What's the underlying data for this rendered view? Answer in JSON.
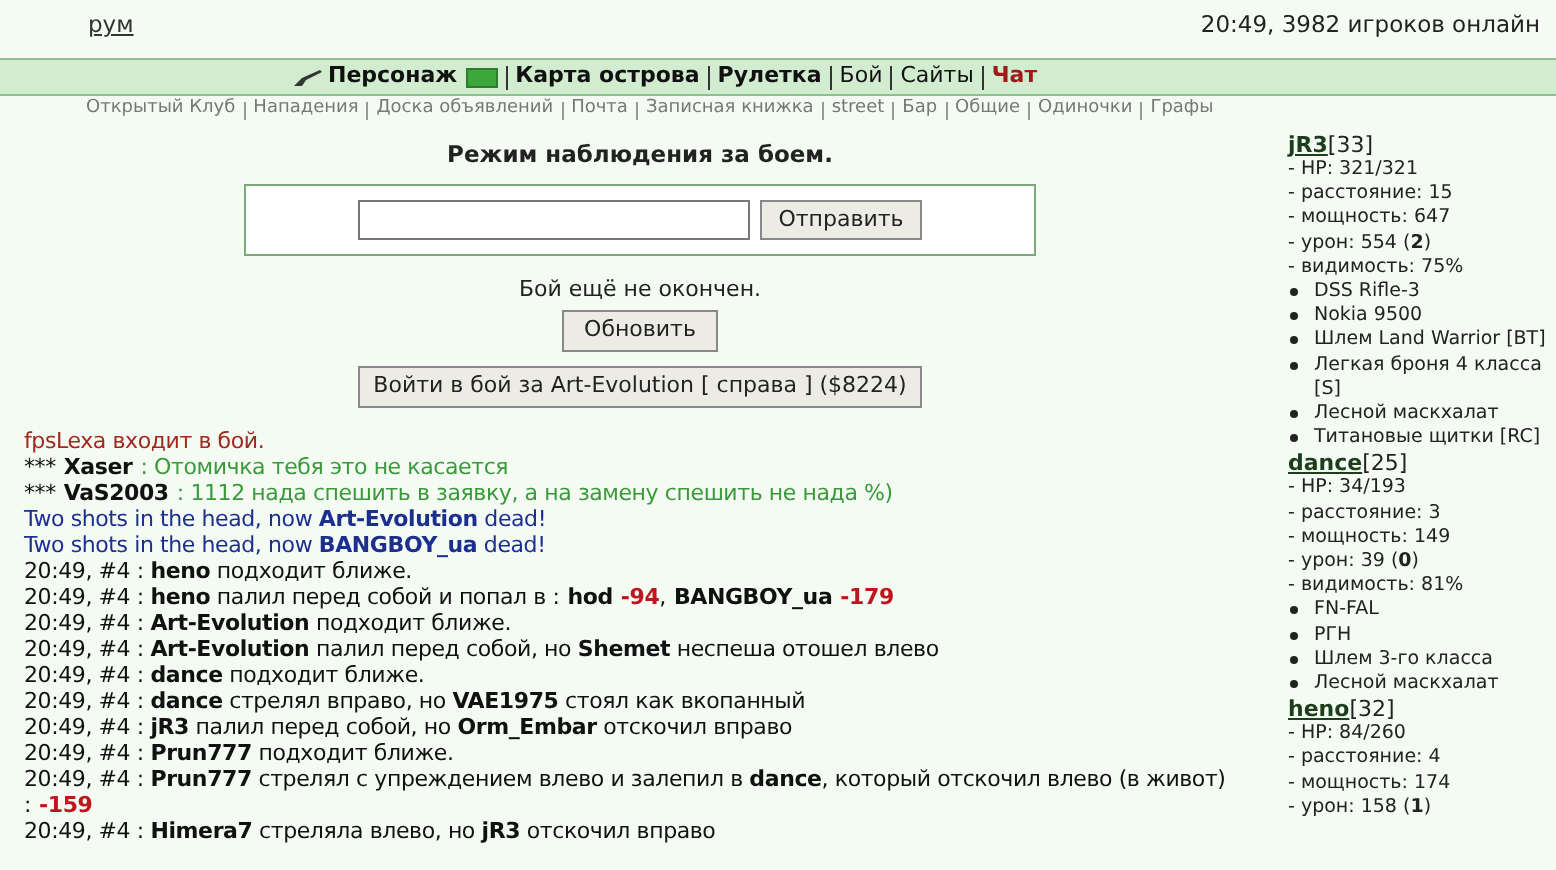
{
  "top_links": [
    "рум"
  ],
  "status": "20:49, 3982 игроков онлайн",
  "nav": [
    {
      "label": "Персонаж",
      "bold": true,
      "selected": false,
      "kind": "character"
    },
    {
      "label": "Карта острова",
      "bold": true,
      "selected": false,
      "kind": "plain"
    },
    {
      "label": "Рулетка",
      "bold": true,
      "selected": false,
      "kind": "plain"
    },
    {
      "label": "Бой",
      "bold": false,
      "selected": false,
      "kind": "plain"
    },
    {
      "label": "Сайты",
      "bold": false,
      "selected": false,
      "kind": "plain"
    },
    {
      "label": "Чат",
      "bold": true,
      "selected": true,
      "kind": "plain"
    }
  ],
  "subnav": [
    "Открытый Клуб",
    "Нападения",
    "Доска объявлений",
    "Почта",
    "Записная книжка",
    "street",
    "Бар",
    "Общие",
    "Одиночки",
    "Графы"
  ],
  "title": "Режим наблюдения за боем.",
  "send_button": "Отправить",
  "battle_status": "Бой ещё не окончен.",
  "refresh_button": "Обновить",
  "join_button": "Войти в бой за Art-Evolution [ справа ] ($8224)",
  "chat": [
    {
      "kind": "system",
      "text": "fpsLexa входит в бой."
    },
    {
      "kind": "chat",
      "prefix": "***",
      "author": "Xaser",
      "message": ": Отомичка тебя это не касается"
    },
    {
      "kind": "chat",
      "prefix": "***",
      "author": "VaS2003",
      "message": ": 1112 нада спешить в заявку, а на замену спешить не нада %)"
    },
    {
      "kind": "dead",
      "text": "Two shots in the head, now **Art-Evolution** dead!"
    },
    {
      "kind": "dead",
      "text": "Two shots in the head, now **BANGBOY_ua** dead!"
    },
    {
      "kind": "log",
      "text": "20:49, #4 : **heno** подходит ближе."
    },
    {
      "kind": "log",
      "text": "20:49, #4 : **heno** палил перед собой и попал в :",
      "hits": [
        {
          "name": "hod",
          "damage": "-94",
          "after": ","
        },
        {
          "name": "BANGBOY_ua",
          "damage": "-179"
        }
      ]
    },
    {
      "kind": "log",
      "text": "20:49, #4 : **Art-Evolution** подходит ближе."
    },
    {
      "kind": "log",
      "text": "20:49, #4 : **Art-Evolution** палил перед собой, но **Shemet** неспеша отошел влево"
    },
    {
      "kind": "log",
      "text": "20:49, #4 : **dance** подходит ближе."
    },
    {
      "kind": "log",
      "text": "20:49, #4 : **dance** стрелял вправо, но **VAE1975** стоял как вкопанный"
    },
    {
      "kind": "log",
      "text": "20:49, #4 : **jR3** палил перед собой, но **Orm_Embar** отскочил вправо"
    },
    {
      "kind": "log",
      "text": "20:49, #4 : **Prun777** подходит ближе."
    },
    {
      "kind": "log",
      "text": "20:49, #4 : **Prun777** стрелял с упреждением влево и залепил в **dance**, который отскочил влево (в живот) :",
      "damage": "-159"
    },
    {
      "kind": "log",
      "text": "20:49, #4 : **Himera7** стреляла влево, но **jR3** отскочил вправо"
    }
  ],
  "players": [
    {
      "name": "jR3",
      "level": "[33]",
      "stats": [
        "- HP: 321/321",
        "- расстояние: 15",
        "- мощность: 647",
        "- урон: 554 (**2**)",
        "- видимость: 75%"
      ],
      "items": [
        "DSS Rifle-3",
        "Nokia 9500",
        "Шлем Land Warrior [BT]",
        "Легкая броня 4 класса [S]",
        "Лесной маскхалат",
        "Титановые щитки [RC]"
      ]
    },
    {
      "name": "dance",
      "level": "[25]",
      "stats": [
        "- HP: 34/193",
        "- расстояние: 3",
        "- мощность: 149",
        "- урон: 39 (**0**)",
        "- видимость: 81%"
      ],
      "items": [
        "FN-FAL",
        "РГН",
        "Шлем 3-го класса",
        "Лесной маскхалат"
      ]
    },
    {
      "name": "heno",
      "level": "[32]",
      "stats": [
        "- HP: 84/260",
        "- расстояние: 4",
        "- мощность: 174",
        "- урон: 158 (**1**)"
      ]
    }
  ]
}
